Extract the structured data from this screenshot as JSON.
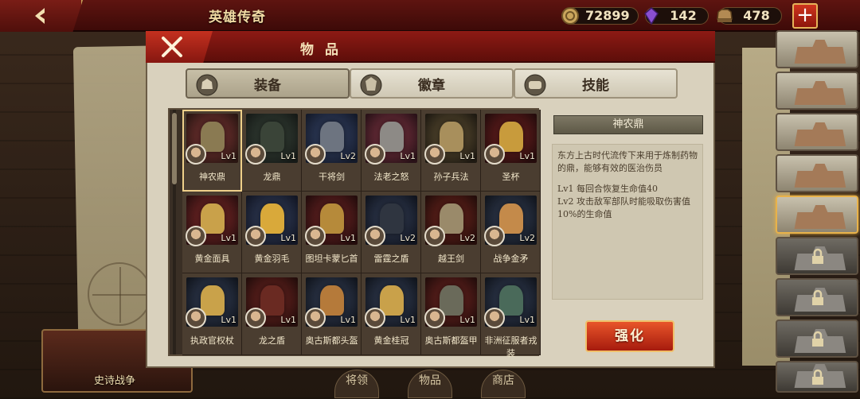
{
  "top_bar": {
    "title": "英雄传奇",
    "resources": {
      "coins": "72899",
      "gems": "142",
      "supplies": "478"
    }
  },
  "modal": {
    "title": "物 品",
    "tabs": [
      {
        "label": "装备",
        "icon": "helmet-icon",
        "active": true
      },
      {
        "label": "徽章",
        "icon": "badge-icon",
        "active": false
      },
      {
        "label": "技能",
        "icon": "scroll-icon",
        "active": false
      }
    ],
    "items": [
      {
        "name": "神农鼎",
        "level": "Lv1",
        "colors": [
          "#8a3b3b",
          "#2a1612",
          "#8a7a52"
        ]
      },
      {
        "name": "龙鼎",
        "level": "Lv1",
        "colors": [
          "#3d4a3f",
          "#161a17",
          "#3a4438"
        ]
      },
      {
        "name": "干将剑",
        "level": "Lv2",
        "colors": [
          "#3a4a70",
          "#141a2a",
          "#6d7480"
        ]
      },
      {
        "name": "法老之怒",
        "level": "Lv1",
        "colors": [
          "#8b3b4a",
          "#2a1218",
          "#8d8a86"
        ]
      },
      {
        "name": "孙子兵法",
        "level": "Lv1",
        "colors": [
          "#6a5a3a",
          "#1f1a12",
          "#a88f5c"
        ]
      },
      {
        "name": "圣杯",
        "level": "Lv1",
        "colors": [
          "#7a2424",
          "#250c0c",
          "#c89b3c"
        ]
      },
      {
        "name": "黄金面具",
        "level": "Lv1",
        "colors": [
          "#8b2d2d",
          "#2a0f0f",
          "#c9a14a"
        ]
      },
      {
        "name": "黄金羽毛",
        "level": "Lv1",
        "colors": [
          "#3a4766",
          "#121624",
          "#d9a93a"
        ]
      },
      {
        "name": "图坦卡蒙匕首",
        "level": "Lv1",
        "colors": [
          "#7a2a2a",
          "#240c0c",
          "#b68a3a"
        ]
      },
      {
        "name": "雷霆之盾",
        "level": "Lv2",
        "colors": [
          "#3a4660",
          "#10141e",
          "#2f3540"
        ]
      },
      {
        "name": "越王剑",
        "level": "Lv2",
        "colors": [
          "#7a2a22",
          "#240d0a",
          "#9a8a6a"
        ]
      },
      {
        "name": "战争金矛",
        "level": "Lv2",
        "colors": [
          "#3a465e",
          "#11151d",
          "#c48a4a"
        ]
      },
      {
        "name": "执政官权杖",
        "level": "Lv1",
        "colors": [
          "#3a4660",
          "#11151d",
          "#c9a24a"
        ]
      },
      {
        "name": "龙之盾",
        "level": "Lv1",
        "colors": [
          "#7a2a26",
          "#240d0b",
          "#6a2a22"
        ]
      },
      {
        "name": "奥古斯都头盔",
        "level": "Lv1",
        "colors": [
          "#3a4660",
          "#11151d",
          "#b57a3a"
        ]
      },
      {
        "name": "黄金桂冠",
        "level": "Lv1",
        "colors": [
          "#3a4660",
          "#11151d",
          "#c9a14a"
        ]
      },
      {
        "name": "奥古斯都盔甲",
        "level": "Lv1",
        "colors": [
          "#7a2a26",
          "#240d0b",
          "#6a6a5a"
        ]
      },
      {
        "name": "非洲征服者戎装",
        "level": "Lv1",
        "colors": [
          "#3a4660",
          "#11151d",
          "#4a6a5a"
        ]
      }
    ],
    "detail": {
      "title": "神农鼎",
      "description": "东方上古时代流传下来用于炼制药物的鼎，能够有效的医治伤员",
      "level1": "Lv1  每回合恢复生命值40",
      "level2": "Lv2  攻击敌军部队时能吸取伤害值10%的生命值"
    },
    "upgrade_label": "强化"
  },
  "background": {
    "epic_war_label": "史诗战争",
    "bottom_tabs": [
      "将领",
      "物品",
      "商店"
    ]
  }
}
